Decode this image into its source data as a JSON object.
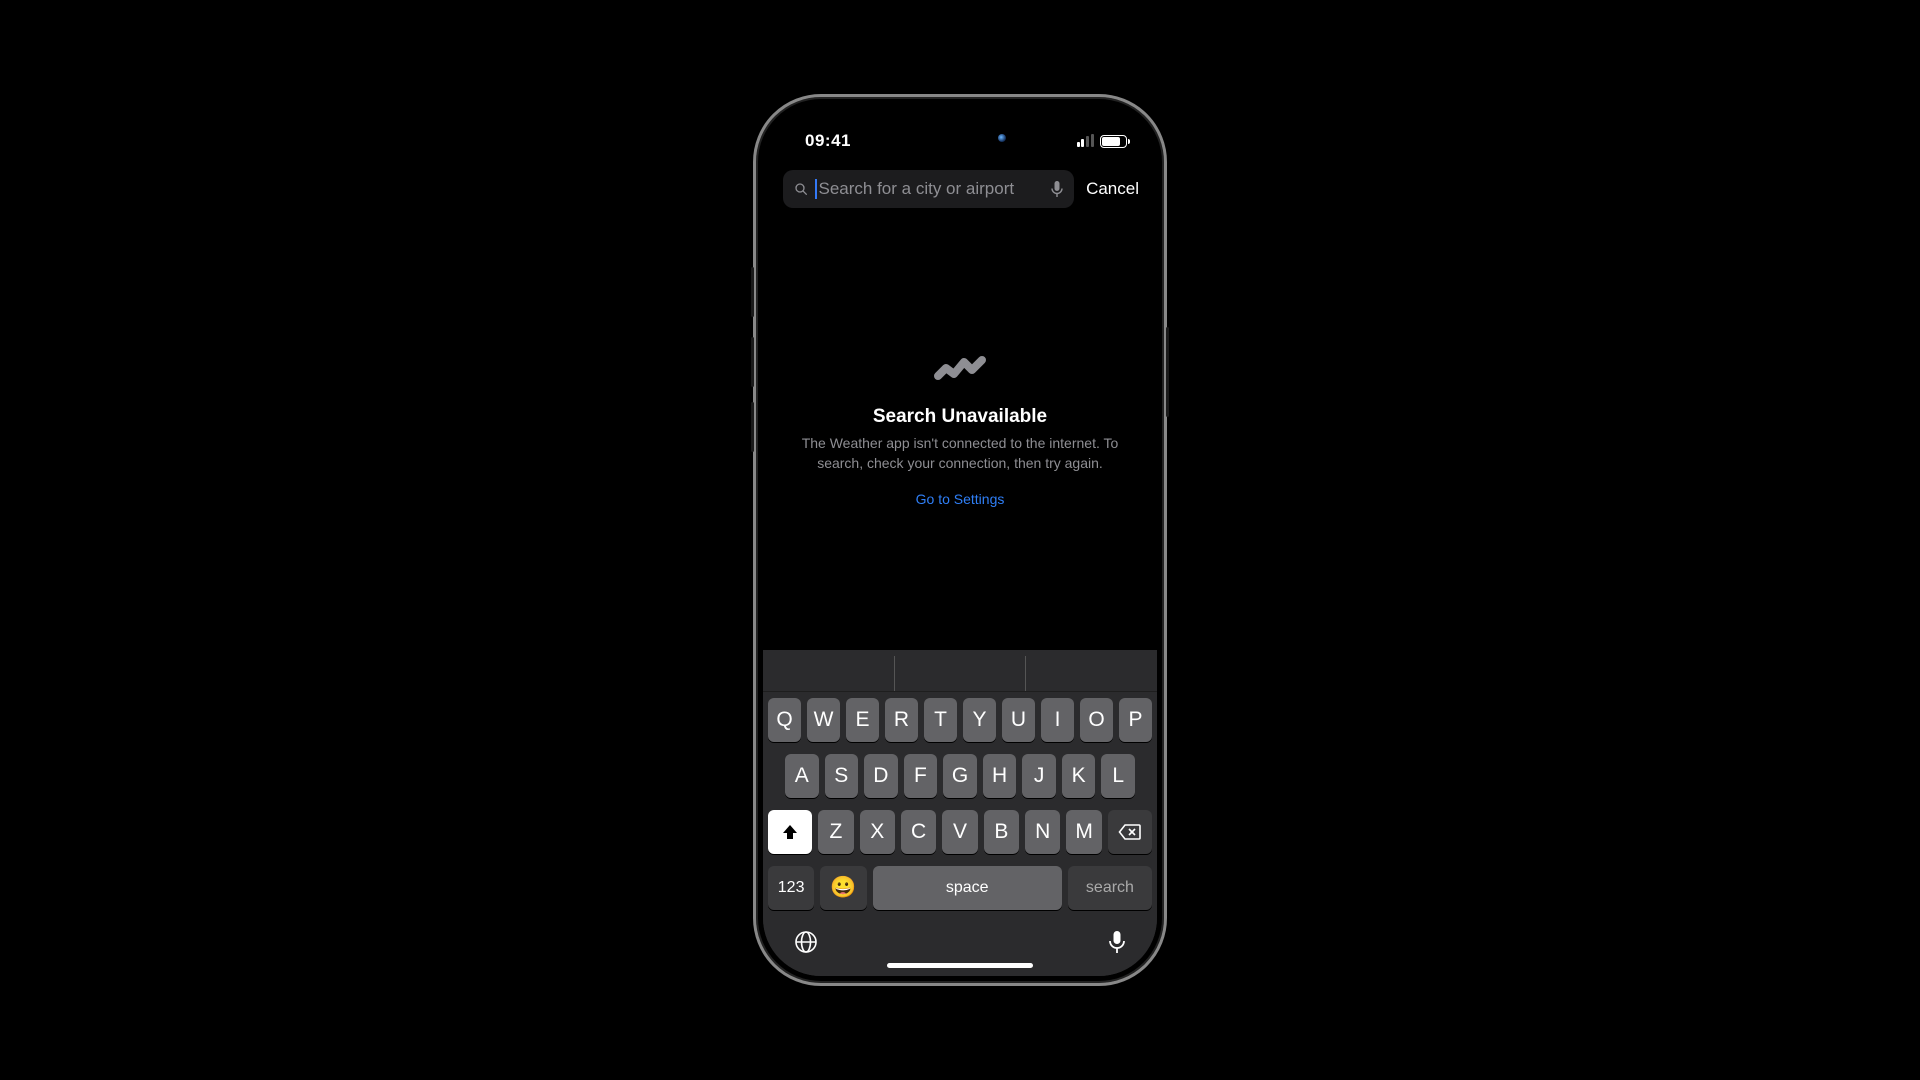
{
  "status": {
    "time": "09:41"
  },
  "search": {
    "placeholder": "Search for a city or airport",
    "cancel": "Cancel"
  },
  "empty_state": {
    "title": "Search Unavailable",
    "body": "The Weather app isn't connected to the internet. To search, check your connection, then try again.",
    "settings_link": "Go to Settings"
  },
  "keyboard": {
    "row1": [
      "Q",
      "W",
      "E",
      "R",
      "T",
      "Y",
      "U",
      "I",
      "O",
      "P"
    ],
    "row2": [
      "A",
      "S",
      "D",
      "F",
      "G",
      "H",
      "J",
      "K",
      "L"
    ],
    "row3": [
      "Z",
      "X",
      "C",
      "V",
      "B",
      "N",
      "M"
    ],
    "numbers_label": "123",
    "space_label": "space",
    "return_label": "search",
    "emoji_label": "😀"
  }
}
